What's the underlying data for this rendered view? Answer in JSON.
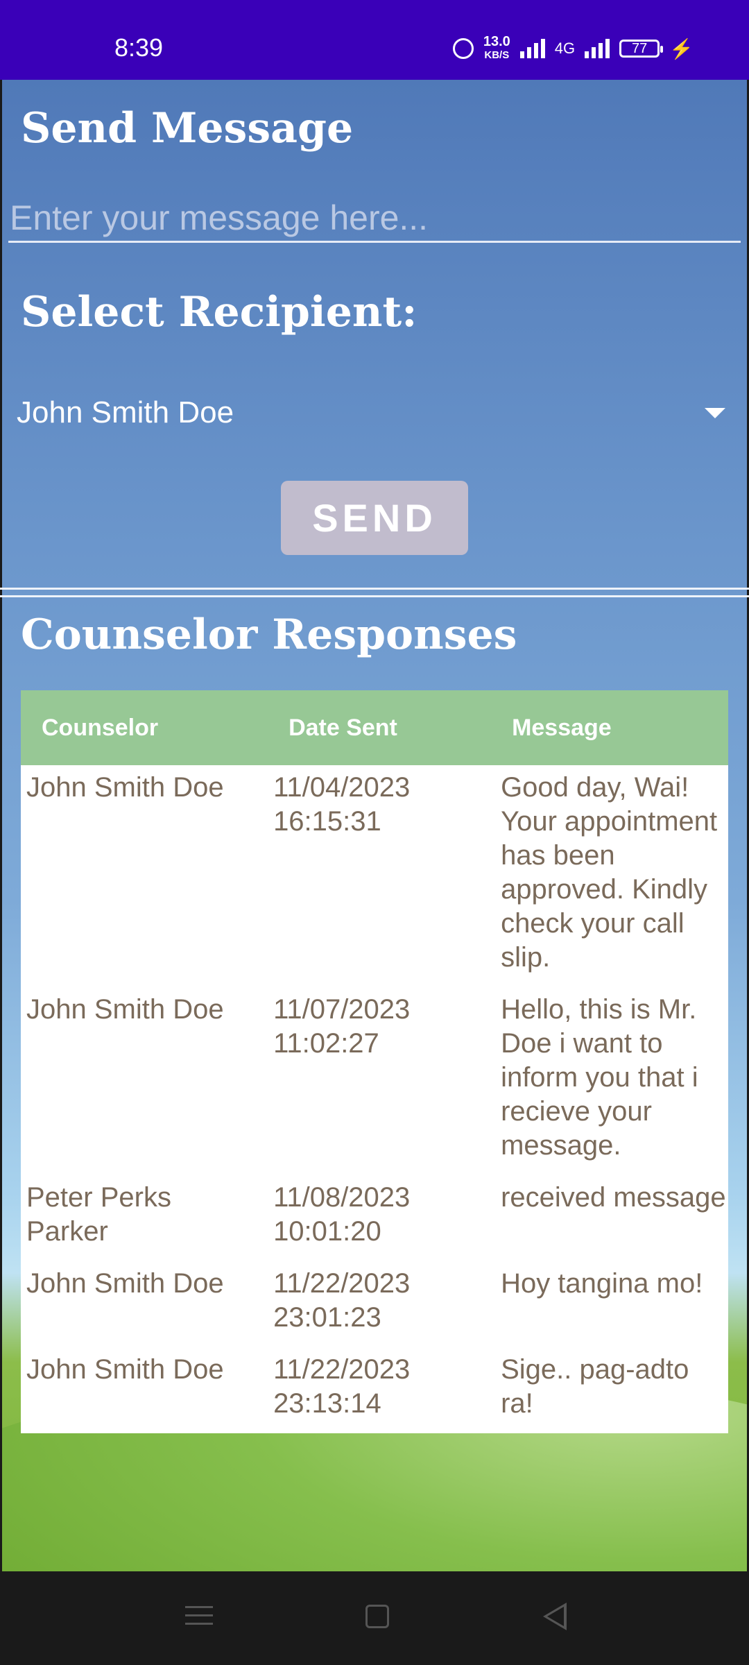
{
  "status_bar": {
    "time": "8:39",
    "net_speed": "13.0",
    "net_unit": "KB/S",
    "network": "4G",
    "battery": "77"
  },
  "send_section": {
    "title": "Send Message",
    "message_placeholder": "Enter your message here...",
    "recipient_label": "Select Recipient:",
    "selected_recipient": "John Smith Doe",
    "send_label": "SEND"
  },
  "responses_section": {
    "title": "Counselor Responses",
    "columns": [
      "Counselor",
      "Date Sent",
      "Message"
    ],
    "rows": [
      {
        "counselor": "John Smith Doe",
        "date": "11/04/2023 16:15:31",
        "message": "Good day, Wai! Your appointment has been approved. Kindly check your call slip."
      },
      {
        "counselor": "John Smith Doe",
        "date": "11/07/2023 11:02:27",
        "message": "Hello, this is Mr. Doe i want to inform you that i recieve your message."
      },
      {
        "counselor": "Peter Perks Parker",
        "date": "11/08/2023 10:01:20",
        "message": "received message"
      },
      {
        "counselor": "John Smith Doe",
        "date": "11/22/2023 23:01:23",
        "message": "Hoy tangina mo!"
      },
      {
        "counselor": "John Smith Doe",
        "date": "11/22/2023 23:13:14",
        "message": "Sige.. pag-adto ra!"
      }
    ]
  },
  "colors": {
    "status_bar": "#3a00b8",
    "table_header": "#97c895",
    "send_button": "#c1bccd",
    "table_text": "#7a6a5a"
  },
  "icons": [
    "alarm-icon",
    "signal-icon",
    "battery-icon",
    "charging-icon",
    "dropdown-caret-icon",
    "menu-nav-icon",
    "home-nav-icon",
    "back-nav-icon"
  ]
}
